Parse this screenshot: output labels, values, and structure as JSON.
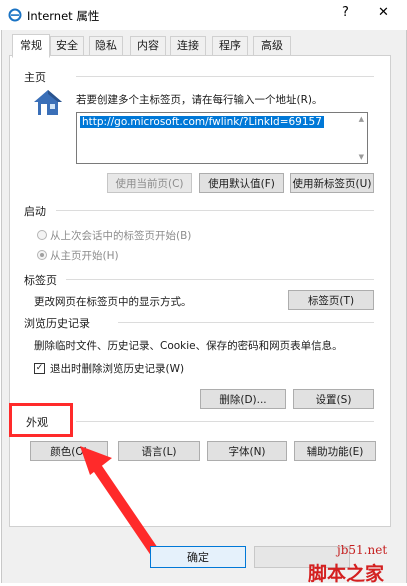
{
  "window": {
    "title": "Internet 属性",
    "help_glyph": "?",
    "close_glyph": "✕"
  },
  "tabs": [
    {
      "label": "常规"
    },
    {
      "label": "安全"
    },
    {
      "label": "隐私"
    },
    {
      "label": "内容"
    },
    {
      "label": "连接"
    },
    {
      "label": "程序"
    },
    {
      "label": "高级"
    }
  ],
  "home": {
    "section_title": "主页",
    "instruction": "若要创建多个主标签页，请在每行输入一个地址(R)。",
    "url": "http://go.microsoft.com/fwlink/?LinkId=69157",
    "btn_current": "使用当前页(C)",
    "btn_default": "使用默认值(F)",
    "btn_newtab": "使用新标签页(U)"
  },
  "startup": {
    "section_title": "启动",
    "option_last": "从上次会话中的标签页开始(B)",
    "option_home": "从主页开始(H)"
  },
  "tabs_section": {
    "section_title": "标签页",
    "description": "更改网页在标签页中的显示方式。",
    "btn": "标签页(T)"
  },
  "history": {
    "section_title": "浏览历史记录",
    "description": "删除临时文件、历史记录、Cookie、保存的密码和网页表单信息。",
    "checkbox_label": "退出时删除浏览历史记录(W)",
    "btn_delete": "删除(D)...",
    "btn_settings": "设置(S)"
  },
  "appearance": {
    "section_title": "外观",
    "btn_colors": "颜色(O)",
    "btn_languages": "语言(L)",
    "btn_fonts": "字体(N)",
    "btn_accessibility": "辅助功能(E)"
  },
  "dialog_buttons": {
    "ok": "确定"
  },
  "watermark": {
    "site": "jb51.net",
    "brand": "脚本之家"
  },
  "colors": {
    "accent": "#0078d7",
    "annotation": "#ff2a2a"
  }
}
